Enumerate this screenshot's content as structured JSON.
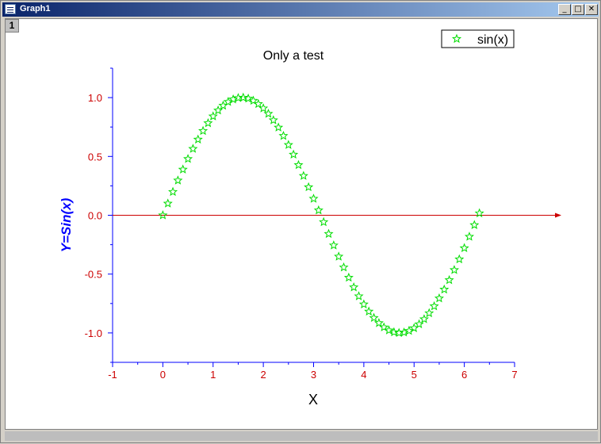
{
  "window": {
    "title": "Graph1",
    "minimize_label": "_",
    "maximize_label": "□",
    "close_label": "✕",
    "layer_number": "1"
  },
  "chart_data": {
    "type": "scatter",
    "title": "Only a test",
    "xlabel": "X",
    "ylabel": "Y=Sin(x)",
    "xlim": [
      -1,
      7
    ],
    "ylim": [
      -1.25,
      1.25
    ],
    "x_ticks": [
      -1,
      0,
      1,
      2,
      3,
      4,
      5,
      6,
      7
    ],
    "y_ticks": [
      -1.0,
      -0.5,
      0.0,
      0.5,
      1.0
    ],
    "x_tick_labels": [
      "-1",
      "0",
      "1",
      "2",
      "3",
      "4",
      "5",
      "6",
      "7"
    ],
    "y_tick_labels": [
      "-1.0",
      "-0.5",
      "0.0",
      "0.5",
      "1.0"
    ],
    "marker": "star",
    "legend_position": "top-right",
    "reference_line_y": 0,
    "colors": {
      "series": "#00dd00",
      "axis": "#0000ff",
      "tick_labels": "#cc0000",
      "ylabel": "#0000ff",
      "reference_line": "#cc0000",
      "title": "#000000"
    },
    "series": [
      {
        "name": "sin(x)",
        "x": [
          0.0,
          0.1,
          0.2,
          0.3,
          0.4,
          0.5,
          0.6,
          0.7,
          0.8,
          0.9,
          1.0,
          1.1,
          1.2,
          1.3,
          1.4,
          1.5,
          1.6,
          1.7,
          1.8,
          1.9,
          2.0,
          2.1,
          2.2,
          2.3,
          2.4,
          2.5,
          2.6,
          2.7,
          2.8,
          2.9,
          3.0,
          3.1,
          3.2,
          3.3,
          3.4,
          3.5,
          3.6,
          3.7,
          3.8,
          3.9,
          4.0,
          4.1,
          4.2,
          4.3,
          4.4,
          4.5,
          4.6,
          4.7,
          4.8,
          4.9,
          5.0,
          5.1,
          5.2,
          5.3,
          5.4,
          5.5,
          5.6,
          5.7,
          5.8,
          5.9,
          6.0,
          6.1,
          6.2,
          6.3
        ],
        "y": [
          0.0,
          0.1,
          0.199,
          0.296,
          0.389,
          0.479,
          0.565,
          0.644,
          0.717,
          0.783,
          0.841,
          0.891,
          0.932,
          0.964,
          0.985,
          0.997,
          1.0,
          0.992,
          0.974,
          0.946,
          0.909,
          0.863,
          0.808,
          0.746,
          0.675,
          0.598,
          0.516,
          0.427,
          0.335,
          0.239,
          0.141,
          0.042,
          -0.058,
          -0.158,
          -0.256,
          -0.351,
          -0.443,
          -0.53,
          -0.612,
          -0.688,
          -0.757,
          -0.818,
          -0.872,
          -0.916,
          -0.952,
          -0.978,
          -0.994,
          -1.0,
          -0.996,
          -0.982,
          -0.959,
          -0.926,
          -0.883,
          -0.832,
          -0.773,
          -0.706,
          -0.631,
          -0.551,
          -0.465,
          -0.374,
          -0.279,
          -0.182,
          -0.083,
          0.017
        ]
      }
    ]
  }
}
